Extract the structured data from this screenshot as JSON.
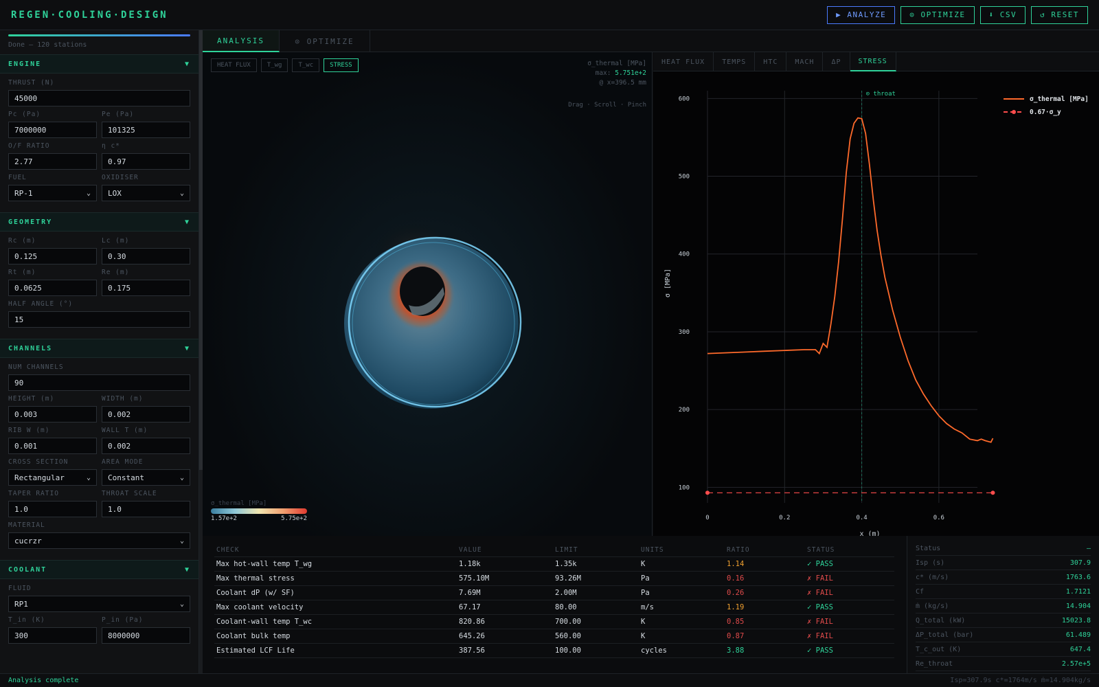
{
  "app": {
    "title": "REGEN·COOLING·DESIGN"
  },
  "toolbar": {
    "analyze": "▶ ANALYZE",
    "optimize": "⊙ OPTIMIZE",
    "csv": "⬇ CSV",
    "reset": "↺ RESET"
  },
  "progress": {
    "fraction": 1.0,
    "text": "Done — 120 stations"
  },
  "sidebar": {
    "engine": {
      "title": "ENGINE",
      "thrust_label": "THRUST (N)",
      "thrust": "45000",
      "pc_label": "Pc (Pa)",
      "pc": "7000000",
      "pe_label": "Pe (Pa)",
      "pe": "101325",
      "of_label": "O/F RATIO",
      "of": "2.77",
      "eta_label": "η c*",
      "eta": "0.97",
      "fuel_label": "FUEL",
      "fuel": "RP-1",
      "ox_label": "OXIDISER",
      "ox": "LOX"
    },
    "geometry": {
      "title": "GEOMETRY",
      "rc_label": "Rc (m)",
      "rc": "0.125",
      "lc_label": "Lc (m)",
      "lc": "0.30",
      "rt_label": "Rt (m)",
      "rt": "0.0625",
      "re_label": "Re (m)",
      "re": "0.175",
      "half_label": "HALF ANGLE (°)",
      "half": "15"
    },
    "channels": {
      "title": "CHANNELS",
      "num_label": "NUM CHANNELS",
      "num": "90",
      "h_label": "HEIGHT (m)",
      "h": "0.003",
      "w_label": "WIDTH (m)",
      "w": "0.002",
      "rib_label": "RIB W (m)",
      "rib": "0.001",
      "wall_label": "WALL T (m)",
      "wall": "0.002",
      "cs_label": "CROSS SECTION",
      "cs": "Rectangular",
      "am_label": "AREA MODE",
      "am": "Constant",
      "tr_label": "TAPER RATIO",
      "tr": "1.0",
      "ts_label": "THROAT SCALE",
      "ts": "1.0",
      "mat_label": "MATERIAL",
      "mat": "cucrzr"
    },
    "coolant": {
      "title": "COOLANT",
      "fluid_label": "FLUID",
      "fluid": "RP1",
      "tin_label": "T_in (K)",
      "tin": "300",
      "pin_label": "P_in (Pa)",
      "pin": "8000000"
    },
    "chevron": "▼"
  },
  "main_tabs": {
    "analysis": "ANALYSIS",
    "optimize": "⊙ OPTIMIZE"
  },
  "viewport": {
    "tabs": [
      "HEAT FLUX",
      "T_wg",
      "T_wc",
      "STRESS"
    ],
    "active_tab": "STRESS",
    "field_label": "σ_thermal [MPa]",
    "max_prefix": "max:",
    "max_value": "5.751e+2",
    "at_text": "@ x=396.5 mm",
    "hint": "Drag · Scroll · Pinch",
    "legend_title": "σ_thermal [MPa]",
    "legend_min": "1.57e+2",
    "legend_max": "5.75e+2"
  },
  "plot_tabs": [
    "HEAT FLUX",
    "TEMPS",
    "HTC",
    "MACH",
    "ΔP",
    "STRESS"
  ],
  "chart_data": {
    "type": "line",
    "xlabel": "x (m)",
    "ylabel": "σ [MPa]",
    "xlim": [
      0,
      0.7
    ],
    "ylim": [
      80,
      610
    ],
    "xticks": [
      0,
      0.2,
      0.4,
      0.6
    ],
    "yticks": [
      100,
      200,
      300,
      400,
      500,
      600
    ],
    "grid": true,
    "legend_position": "top-right",
    "annotation": {
      "label": "⊙ throat",
      "x": 0.4
    },
    "series": [
      {
        "name": "σ_thermal [MPa]",
        "color": "#ff6a2b",
        "style": "solid",
        "x": [
          0,
          0.05,
          0.1,
          0.15,
          0.2,
          0.25,
          0.28,
          0.29,
          0.3,
          0.31,
          0.32,
          0.33,
          0.34,
          0.35,
          0.36,
          0.37,
          0.38,
          0.39,
          0.4,
          0.41,
          0.42,
          0.43,
          0.44,
          0.45,
          0.46,
          0.48,
          0.5,
          0.52,
          0.54,
          0.56,
          0.58,
          0.6,
          0.62,
          0.64,
          0.66,
          0.68,
          0.7,
          0.71,
          0.72,
          0.735,
          0.74
        ],
        "y": [
          272,
          273,
          274,
          275,
          276,
          277,
          277,
          272,
          285,
          280,
          310,
          345,
          390,
          445,
          505,
          548,
          568,
          575,
          574,
          555,
          515,
          470,
          430,
          398,
          370,
          328,
          293,
          263,
          238,
          220,
          205,
          192,
          182,
          175,
          170,
          162,
          160,
          162,
          160,
          158,
          163
        ]
      },
      {
        "name": "0.67·σ_y",
        "color": "#ff4d4d",
        "style": "dashed",
        "x": [
          0,
          0.74
        ],
        "y": [
          93,
          93
        ]
      }
    ]
  },
  "checks": {
    "headers": [
      "CHECK",
      "VALUE",
      "LIMIT",
      "UNITS",
      "RATIO",
      "STATUS"
    ],
    "rows": [
      {
        "check": "Max hot-wall temp T_wg",
        "value": "1.18k",
        "limit": "1.35k",
        "units": "K",
        "ratio": "1.14",
        "ratio_class": "warn",
        "status": "✓ PASS",
        "status_class": "pass"
      },
      {
        "check": "Max thermal stress",
        "value": "575.10M",
        "limit": "93.26M",
        "units": "Pa",
        "ratio": "0.16",
        "ratio_class": "fail",
        "status": "✗ FAIL",
        "status_class": "fail"
      },
      {
        "check": "Coolant dP (w/ SF)",
        "value": "7.69M",
        "limit": "2.00M",
        "units": "Pa",
        "ratio": "0.26",
        "ratio_class": "fail",
        "status": "✗ FAIL",
        "status_class": "fail"
      },
      {
        "check": "Max coolant velocity",
        "value": "67.17",
        "limit": "80.00",
        "units": "m/s",
        "ratio": "1.19",
        "ratio_class": "warn",
        "status": "✓ PASS",
        "status_class": "pass"
      },
      {
        "check": "Coolant-wall temp T_wc",
        "value": "820.86",
        "limit": "700.00",
        "units": "K",
        "ratio": "0.85",
        "ratio_class": "fail",
        "status": "✗ FAIL",
        "status_class": "fail"
      },
      {
        "check": "Coolant bulk temp",
        "value": "645.26",
        "limit": "560.00",
        "units": "K",
        "ratio": "0.87",
        "ratio_class": "fail",
        "status": "✗ FAIL",
        "status_class": "fail"
      },
      {
        "check": "Estimated LCF Life",
        "value": "387.56",
        "limit": "100.00",
        "units": "cycles",
        "ratio": "3.88",
        "ratio_class": "okr",
        "status": "✓ PASS",
        "status_class": "pass"
      }
    ]
  },
  "perf": [
    {
      "k": "Status",
      "v": "—"
    },
    {
      "k": "Isp (s)",
      "v": "307.9"
    },
    {
      "k": "c* (m/s)",
      "v": "1763.6"
    },
    {
      "k": "Cf",
      "v": "1.7121"
    },
    {
      "k": "ṁ (kg/s)",
      "v": "14.904"
    },
    {
      "k": "Q_total (kW)",
      "v": "15023.8"
    },
    {
      "k": "ΔP_total (bar)",
      "v": "61.489"
    },
    {
      "k": "T_c_out (K)",
      "v": "647.4"
    },
    {
      "k": "Re_throat",
      "v": "2.57e+5"
    }
  ],
  "statusbar": {
    "left": "Analysis complete",
    "right": "Isp=307.9s c*=1764m/s ṁ=14.904kg/s"
  }
}
